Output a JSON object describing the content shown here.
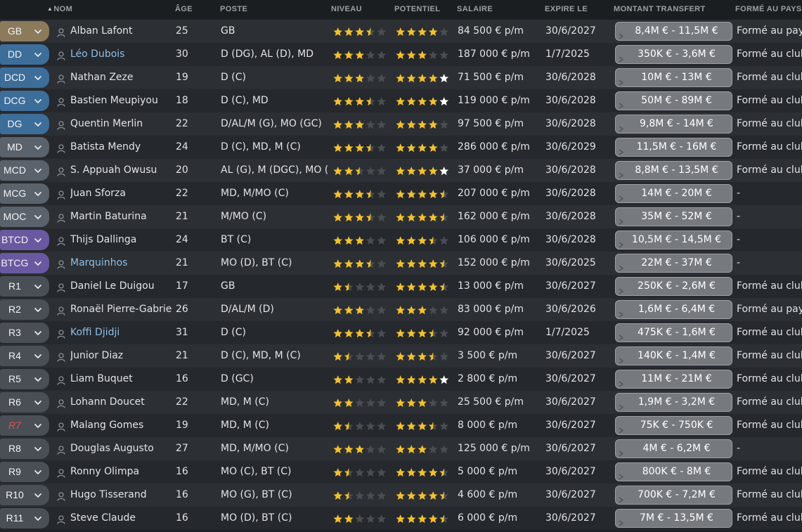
{
  "header": {
    "sort_arrow": "▲",
    "name": "NOM",
    "age": "ÂGE",
    "position": "POSTE",
    "current_ability": "NIVEAU",
    "potential_ability": "POTENTIEL",
    "wage": "SALAIRE",
    "expires": "EXPIRE LE",
    "transfer_value": "MONTANT TRANSFERT",
    "trained": "FORMÉ AU PAYS"
  },
  "colors": {
    "GK": "#8b7a5c",
    "DEF": "#3d6e9a",
    "MID": "#5a626c",
    "ATT": "#6a58a0",
    "RES": "#4a4f55",
    "star": "#f2c12e",
    "star_white": "#ffffff",
    "star_empty": "#4a4e53",
    "link": "#8fbfe8"
  },
  "players": [
    {
      "pos": "GB",
      "group": "GK",
      "name": "Alban Lafont",
      "link": false,
      "age": "25",
      "position": "GB",
      "ability": 3.5,
      "potential": 4,
      "wage": "84 500 € p/m",
      "expires": "30/6/2027",
      "transfer": "8,4M € - 11,5M €",
      "trained": "Formé au pays"
    },
    {
      "pos": "DD",
      "group": "DEF",
      "name": "Léo Dubois",
      "link": true,
      "age": "30",
      "position": "D (DG), AL (D), MD",
      "ability": 3,
      "potential": 3,
      "wage": "187 000 € p/m",
      "expires": "1/7/2025",
      "transfer": "350K € - 3,6M €",
      "trained": "Formé au club"
    },
    {
      "pos": "DCD",
      "group": "DEF",
      "name": "Nathan Zeze",
      "link": false,
      "age": "19",
      "position": "D (C)",
      "ability": 3,
      "potential": 5,
      "potential_white": 1,
      "wage": "71 500 € p/m",
      "expires": "30/6/2028",
      "transfer": "10M € - 13M €",
      "trained": "Formé au club"
    },
    {
      "pos": "DCG",
      "group": "DEF",
      "name": "Bastien Meupiyou",
      "link": false,
      "age": "18",
      "position": "D (C), MD",
      "ability": 3.5,
      "potential": 5,
      "potential_white": 1,
      "wage": "119 000 € p/m",
      "expires": "30/6/2028",
      "transfer": "50M € - 89M €",
      "trained": "Formé au club"
    },
    {
      "pos": "DG",
      "group": "DEF",
      "name": "Quentin Merlin",
      "link": false,
      "age": "22",
      "position": "D/AL/M (G), MO (GC)",
      "ability": 3,
      "potential": 4,
      "wage": "97 500 € p/m",
      "expires": "30/6/2028",
      "transfer": "9,8M € - 14M €",
      "trained": "Formé au club"
    },
    {
      "pos": "MD",
      "group": "MID",
      "name": "Batista Mendy",
      "link": false,
      "age": "24",
      "position": "D (C), MD, M (C)",
      "ability": 3.5,
      "potential": 4,
      "wage": "286 000 € p/m",
      "expires": "30/6/2029",
      "transfer": "11,5M € - 16M €",
      "trained": "Formé au club"
    },
    {
      "pos": "MCD",
      "group": "MID",
      "name": "S. Appuah Owusu",
      "link": false,
      "age": "20",
      "position": "AL (G), M (DGC), MO (…",
      "ability": 2.5,
      "potential": 5,
      "potential_white": 1,
      "wage": "37 000 € p/m",
      "expires": "30/6/2028",
      "transfer": "8,8M € - 13,5M €",
      "trained": "Formé au club"
    },
    {
      "pos": "MCG",
      "group": "MID",
      "name": "Juan Sforza",
      "link": false,
      "age": "22",
      "position": "MD, M/MO (C)",
      "ability": 3.5,
      "potential": 4.5,
      "wage": "207 000 € p/m",
      "expires": "30/6/2028",
      "transfer": "14M € - 20M €",
      "trained": "-"
    },
    {
      "pos": "MOC",
      "group": "MID",
      "name": "Martin Baturina",
      "link": false,
      "age": "21",
      "position": "M/MO (C)",
      "ability": 3.5,
      "potential": 4.5,
      "wage": "162 000 € p/m",
      "expires": "30/6/2028",
      "transfer": "35M € - 52M €",
      "trained": "-"
    },
    {
      "pos": "BTCD",
      "group": "ATT",
      "name": "Thijs Dallinga",
      "link": false,
      "age": "24",
      "position": "BT (C)",
      "ability": 3,
      "potential": 3.5,
      "wage": "106 000 € p/m",
      "expires": "30/6/2028",
      "transfer": "10,5M € - 14,5M €",
      "trained": "-"
    },
    {
      "pos": "BTCG",
      "group": "ATT",
      "name": "Marquinhos",
      "link": true,
      "age": "21",
      "position": "MO (D), BT (C)",
      "ability": 3.5,
      "potential": 4.5,
      "wage": "152 000 € p/m",
      "expires": "30/6/2025",
      "transfer": "22M € - 37M €",
      "trained": "-"
    },
    {
      "pos": "R1",
      "group": "RES",
      "name": "Daniel Le Duigou",
      "link": false,
      "age": "17",
      "position": "GB",
      "ability": 1.5,
      "potential": 4.5,
      "wage": "13 000 € p/m",
      "expires": "30/6/2027",
      "transfer": "250K € - 2,6M €",
      "trained": "Formé au club"
    },
    {
      "pos": "R2",
      "group": "RES",
      "name": "Ronaël Pierre-Gabriel",
      "link": false,
      "age": "26",
      "position": "D/AL/M (D)",
      "ability": 3,
      "potential": 3,
      "wage": "83 000 € p/m",
      "expires": "30/6/2026",
      "transfer": "1,6M € - 6,4M €",
      "trained": "Formé au pays"
    },
    {
      "pos": "R3",
      "group": "RES",
      "name": "Koffi Djidji",
      "link": true,
      "age": "31",
      "position": "D (C)",
      "ability": 3.5,
      "potential": 3.5,
      "wage": "92 000 € p/m",
      "expires": "1/7/2025",
      "transfer": "475K € - 1,6M €",
      "trained": "Formé au club"
    },
    {
      "pos": "R4",
      "group": "RES",
      "name": "Junior Diaz",
      "link": false,
      "age": "21",
      "position": "D (C), MD, M (C)",
      "ability": 1.5,
      "potential": 3.5,
      "wage": "3 500 € p/m",
      "expires": "30/6/2027",
      "transfer": "140K € - 1,4M €",
      "trained": "Formé au club"
    },
    {
      "pos": "R5",
      "group": "RES",
      "name": "Liam Buquet",
      "link": false,
      "age": "16",
      "position": "D (GC)",
      "ability": 2,
      "potential": 5,
      "potential_white": 1,
      "wage": "2 800 € p/m",
      "expires": "30/6/2027",
      "transfer": "11M € - 21M €",
      "trained": "Formé au club"
    },
    {
      "pos": "R6",
      "group": "RES",
      "name": "Lohann Doucet",
      "link": false,
      "age": "22",
      "position": "MD, M (C)",
      "ability": 2,
      "potential": 3,
      "wage": "25 500 € p/m",
      "expires": "30/6/2027",
      "transfer": "1,9M € - 3,2M €",
      "trained": "Formé au club"
    },
    {
      "pos": "R7",
      "group": "RES",
      "pos_red": true,
      "name": "Malang Gomes",
      "link": false,
      "age": "19",
      "position": "MD, M (C)",
      "ability": 1.5,
      "potential": 3.5,
      "wage": "8 000 € p/m",
      "expires": "30/6/2027",
      "transfer": "75K € - 750K €",
      "trained": "Formé au club"
    },
    {
      "pos": "R8",
      "group": "RES",
      "name": "Douglas Augusto",
      "link": false,
      "age": "27",
      "position": "MD, M/MO (C)",
      "ability": 3,
      "potential": 3,
      "wage": "125 000 € p/m",
      "expires": "30/6/2027",
      "transfer": "4M € - 6,2M €",
      "trained": "-"
    },
    {
      "pos": "R9",
      "group": "RES",
      "name": "Ronny Olimpa",
      "link": false,
      "age": "16",
      "position": "MO (C), BT (C)",
      "ability": 1.5,
      "potential": 4.5,
      "wage": "5 000 € p/m",
      "expires": "30/6/2027",
      "transfer": "800K € - 8M €",
      "trained": "Formé au club"
    },
    {
      "pos": "R10",
      "group": "RES",
      "name": "Hugo Tisserand",
      "link": false,
      "age": "16",
      "position": "MO (G), BT (C)",
      "ability": 1.5,
      "potential": 4.5,
      "wage": "4 600 € p/m",
      "expires": "30/6/2027",
      "transfer": "700K € - 7,2M €",
      "trained": "Formé au club"
    },
    {
      "pos": "R11",
      "group": "RES",
      "name": "Steve Claude",
      "link": false,
      "age": "16",
      "position": "MO (D), BT (C)",
      "ability": 2,
      "potential": 4.5,
      "wage": "6 000 € p/m",
      "expires": "30/6/2027",
      "transfer": "7M € - 13,5M €",
      "trained": "Formé au club"
    }
  ]
}
